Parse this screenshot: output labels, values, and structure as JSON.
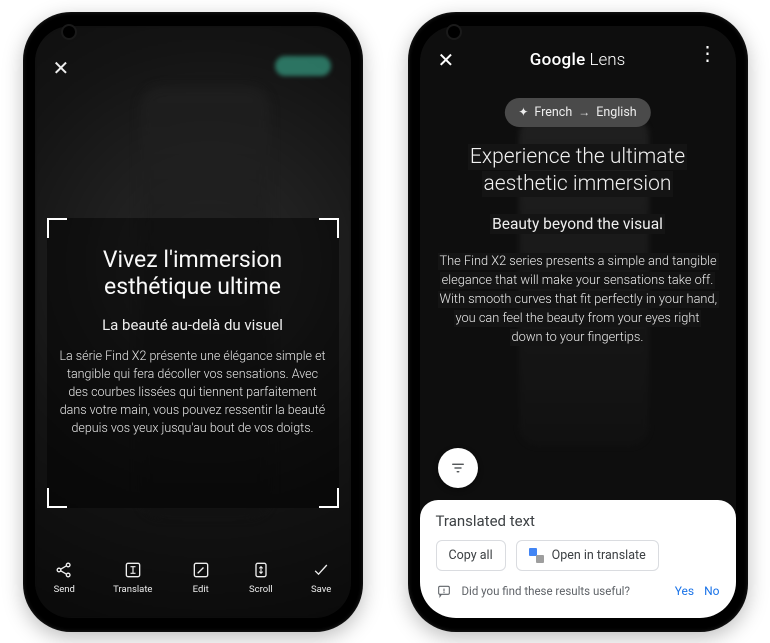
{
  "left": {
    "headline": "Vivez l'immersion esthétique ultime",
    "subhead": "La beauté au-delà du visuel",
    "body": "La série Find X2 présente une élégance simple et tangible qui fera décoller vos sensations. Avec des courbes lissées qui tiennent parfaitement dans votre main, vous pouvez ressentir la beauté depuis vos yeux jusqu'au bout de vos doigts.",
    "toolbar": {
      "send": "Send",
      "translate": "Translate",
      "edit": "Edit",
      "scroll": "Scroll",
      "save": "Save"
    }
  },
  "right": {
    "brand_google": "Google",
    "brand_lens": "Lens",
    "lang_from": "French",
    "lang_to": "English",
    "headline": "Experience the ultimate aesthetic immersion",
    "subhead": "Beauty beyond the visual",
    "body": "The Find X2 series presents a simple and tangible elegance that will make your sensations take off. With smooth curves that fit perfectly in your hand, you can feel the beauty from your eyes right down to your fingertips.",
    "sheet": {
      "title": "Translated text",
      "copy_all": "Copy all",
      "open_translate": "Open in translate",
      "feedback_q": "Did you find these results useful?",
      "yes": "Yes",
      "no": "No"
    }
  }
}
